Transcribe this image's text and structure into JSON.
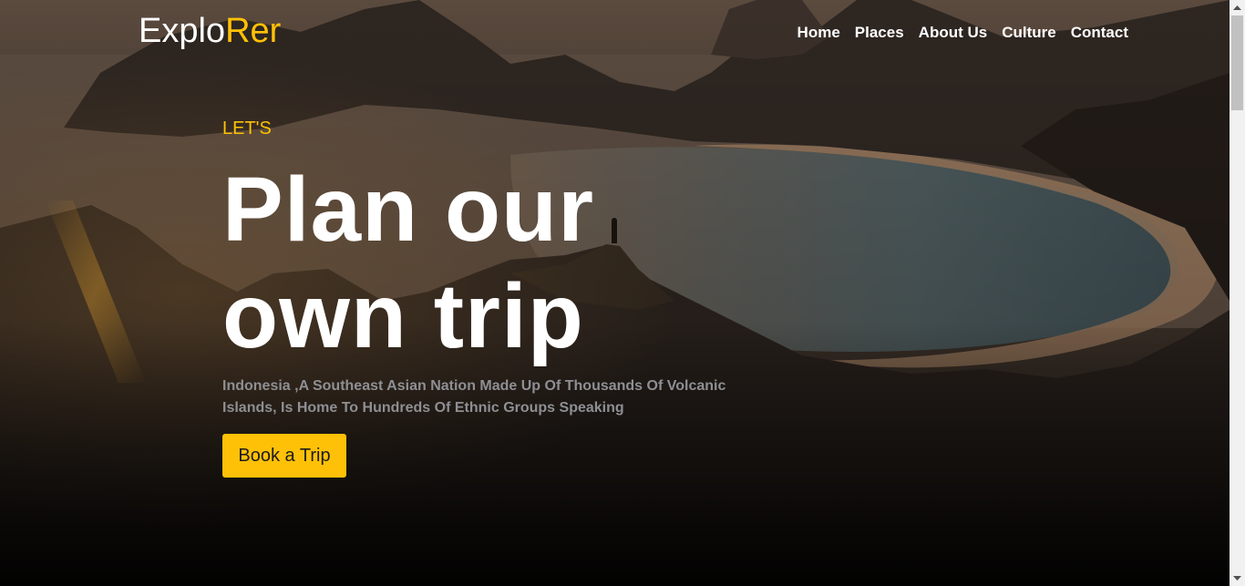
{
  "brand": {
    "logo_part1": "Explo",
    "logo_part2": "Rer",
    "accent_color": "#ffc107"
  },
  "nav": {
    "items": [
      {
        "label": "Home"
      },
      {
        "label": "Places"
      },
      {
        "label": "About Us"
      },
      {
        "label": "Culture"
      },
      {
        "label": "Contact"
      }
    ]
  },
  "hero": {
    "eyebrow": "LET'S",
    "headline_line1": "Plan our",
    "headline_line2": "own trip",
    "description": "Indonesia ,A Southeast Asian Nation Made Up Of Thousands Of Volcanic Islands, Is Home To Hundreds Of Ethnic Groups Speaking",
    "cta_label": "Book a Trip"
  },
  "icons": {
    "scroll_up": "triangle-up-icon",
    "scroll_down": "triangle-down-icon"
  }
}
